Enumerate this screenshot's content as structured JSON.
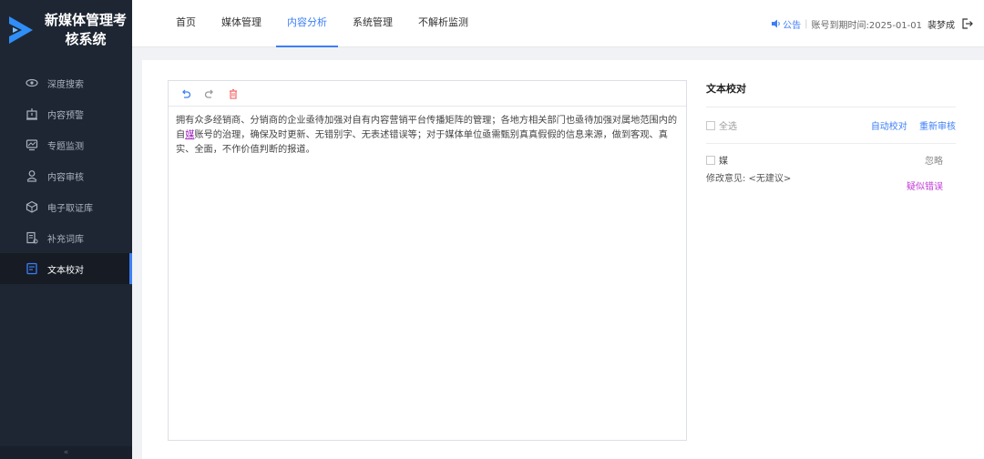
{
  "app": {
    "title_line1": "新媒体管理考",
    "title_line2": "核系统"
  },
  "sidebar": {
    "items": [
      {
        "label": "深度搜索",
        "icon": "eye-icon",
        "active": false
      },
      {
        "label": "内容预警",
        "icon": "alert-icon",
        "active": false
      },
      {
        "label": "专题监测",
        "icon": "monitor-icon",
        "active": false
      },
      {
        "label": "内容审核",
        "icon": "user-check-icon",
        "active": false
      },
      {
        "label": "电子取证库",
        "icon": "cube-icon",
        "active": false
      },
      {
        "label": "补充词库",
        "icon": "dictionary-icon",
        "active": false
      },
      {
        "label": "文本校对",
        "icon": "document-icon",
        "active": true
      }
    ],
    "collapse_label": "«"
  },
  "topnav": {
    "tabs": [
      {
        "label": "首页",
        "active": false
      },
      {
        "label": "媒体管理",
        "active": false
      },
      {
        "label": "内容分析",
        "active": true
      },
      {
        "label": "系统管理",
        "active": false
      },
      {
        "label": "不解析监测",
        "active": false
      }
    ],
    "notice_label": "公告",
    "expiry": "账号到期时间:2025-01-01",
    "username": "裴梦成"
  },
  "editor": {
    "text_before": "拥有众多经销商、分销商的企业亟待加强对自有内容营销平台传播矩阵的管理；各地方相关部门也亟待加强对属地范围内的自",
    "highlight": "媒",
    "text_after": "账号的治理，确保及时更新、无错别字、无表述错误等；对于媒体单位亟需甄别真真假假的信息来源，做到客观、真实、全面，不作价值判断的报道。"
  },
  "proofread": {
    "title": "文本校对",
    "select_all": "全选",
    "auto_check": "自动校对",
    "recheck": "重新审核",
    "items": [
      {
        "word": "媒",
        "ignore": "忽略",
        "suggestion": "修改意见: <无建议>",
        "tag": "疑似错误"
      }
    ]
  },
  "colors": {
    "sidebar_bg": "#1f2633",
    "accent": "#3d7ff7",
    "highlight": "#a020c0",
    "delete": "#f56c6c"
  }
}
